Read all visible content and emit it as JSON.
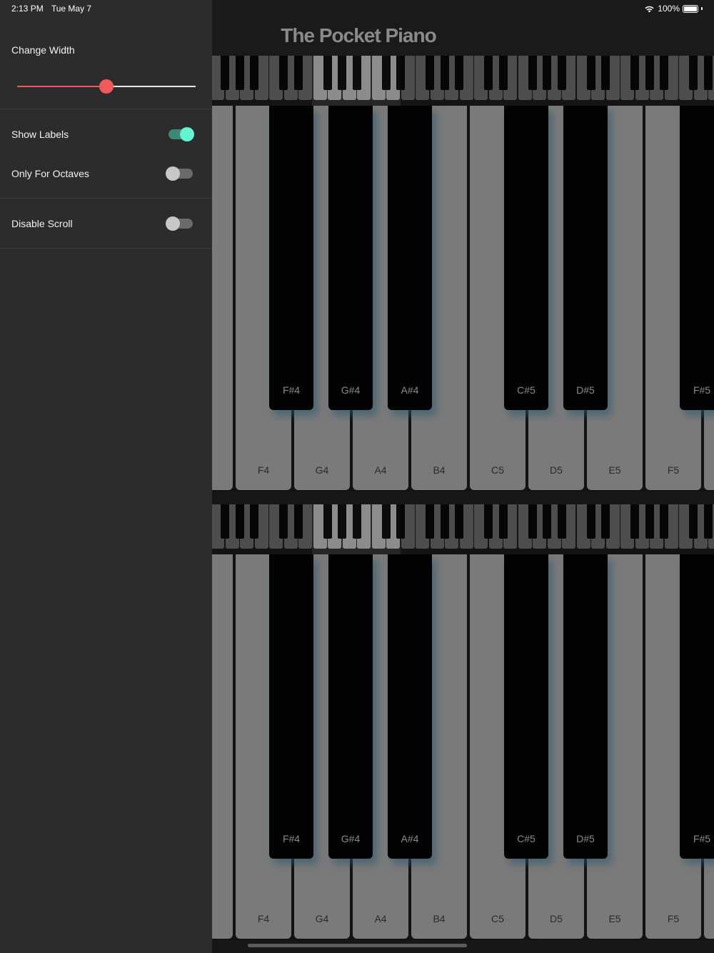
{
  "status_bar": {
    "time": "2:13 PM",
    "date": "Tue May 7",
    "battery": "100%",
    "wifi_icon": "wifi-icon",
    "battery_icon": "battery-icon"
  },
  "app": {
    "title": "The Pocket Piano"
  },
  "settings": {
    "change_width": {
      "label": "Change Width",
      "value_fraction": 0.5,
      "accent": "#f25a5a"
    },
    "show_labels": {
      "label": "Show Labels",
      "on": true
    },
    "only_for_octaves": {
      "label": "Only For Octaves",
      "on": false
    },
    "disable_scroll": {
      "label": "Disable Scroll",
      "on": false
    }
  },
  "keyboards": [
    {
      "white_keys": [
        "",
        "F4",
        "G4",
        "A4",
        "B4",
        "C5",
        "D5",
        "E5",
        "F5",
        ""
      ],
      "black_keys": [
        "F#4",
        "G#4",
        "A#4",
        "C#5",
        "D#5",
        "F#5"
      ]
    },
    {
      "white_keys": [
        "",
        "F4",
        "G4",
        "A4",
        "B4",
        "C5",
        "D5",
        "E5",
        "F5",
        ""
      ],
      "black_keys": [
        "F#4",
        "G#4",
        "A#4",
        "C#5",
        "D#5",
        "F#5"
      ]
    }
  ]
}
